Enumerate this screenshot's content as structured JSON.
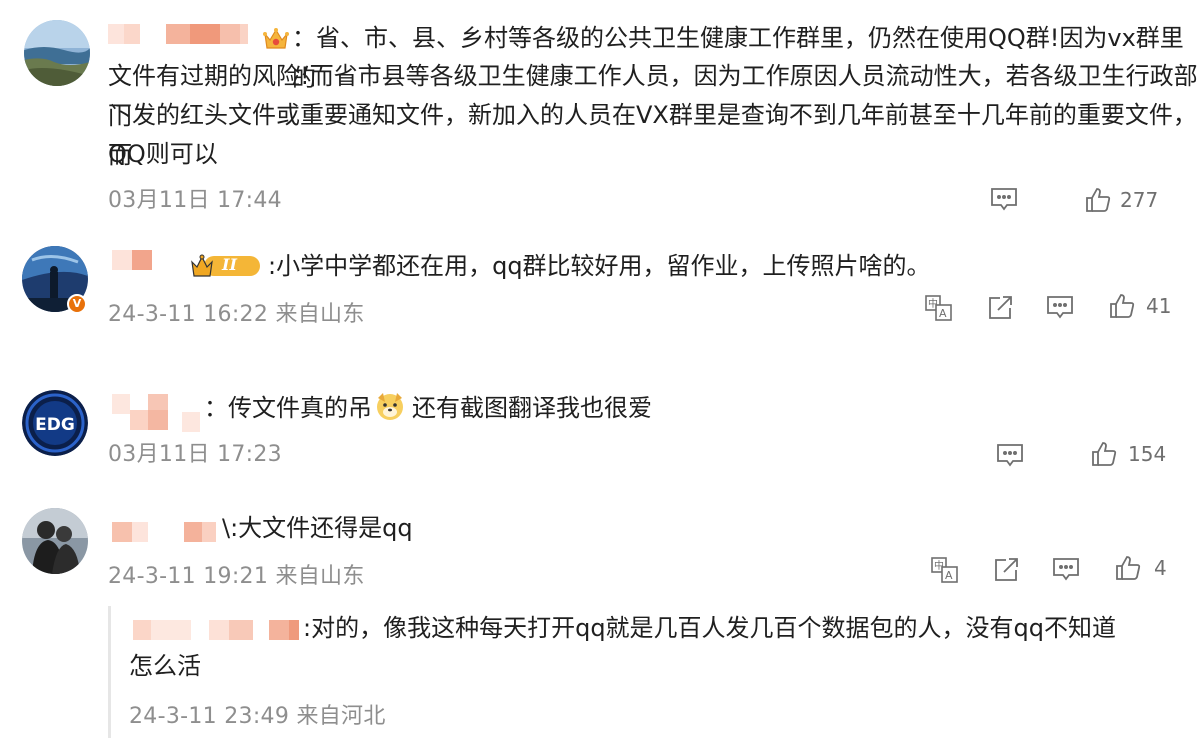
{
  "comments": [
    {
      "text_lines": [
        "：省、市、县、乡村等各级的公共卫生健康工作群里，仍然在使用QQ群!因为vx群里的",
        "文件有过期的风险!而省市县等各级卫生健康工作人员，因为工作原因人员流动性大，若各级卫生行政部门",
        "下发的红头文件或重要通知文件，新加入的人员在VX群里是查询不到几年前甚至十几年前的重要文件，而",
        "QQ则可以"
      ],
      "time": "03月11日 17:44",
      "likes": "277"
    },
    {
      "badge_label": "II",
      "text": ":小学中学都还在用，qq群比较好用，留作业，上传照片啥的。",
      "time": "24-3-11 16:22 来自山东",
      "likes": "41"
    },
    {
      "text_a": "：传文件真的吊",
      "text_b": "还有截图翻译我也很爱",
      "time": "03月11日 17:23",
      "likes": "154"
    },
    {
      "text": "\\:大文件还得是qq",
      "time": "24-3-11 19:21 来自山东",
      "likes": "4",
      "reply": {
        "text_lines": [
          ":对的，像我这种每天打开qq就是几百人发几百个数据包的人，没有qq不知道",
          "怎么活"
        ],
        "time": "24-3-11 23:49 来自河北"
      }
    }
  ],
  "colors": {
    "meta": "#8e8e8e",
    "icon": "#6f6f6f",
    "mosaic_orange": "#f2a58c"
  }
}
